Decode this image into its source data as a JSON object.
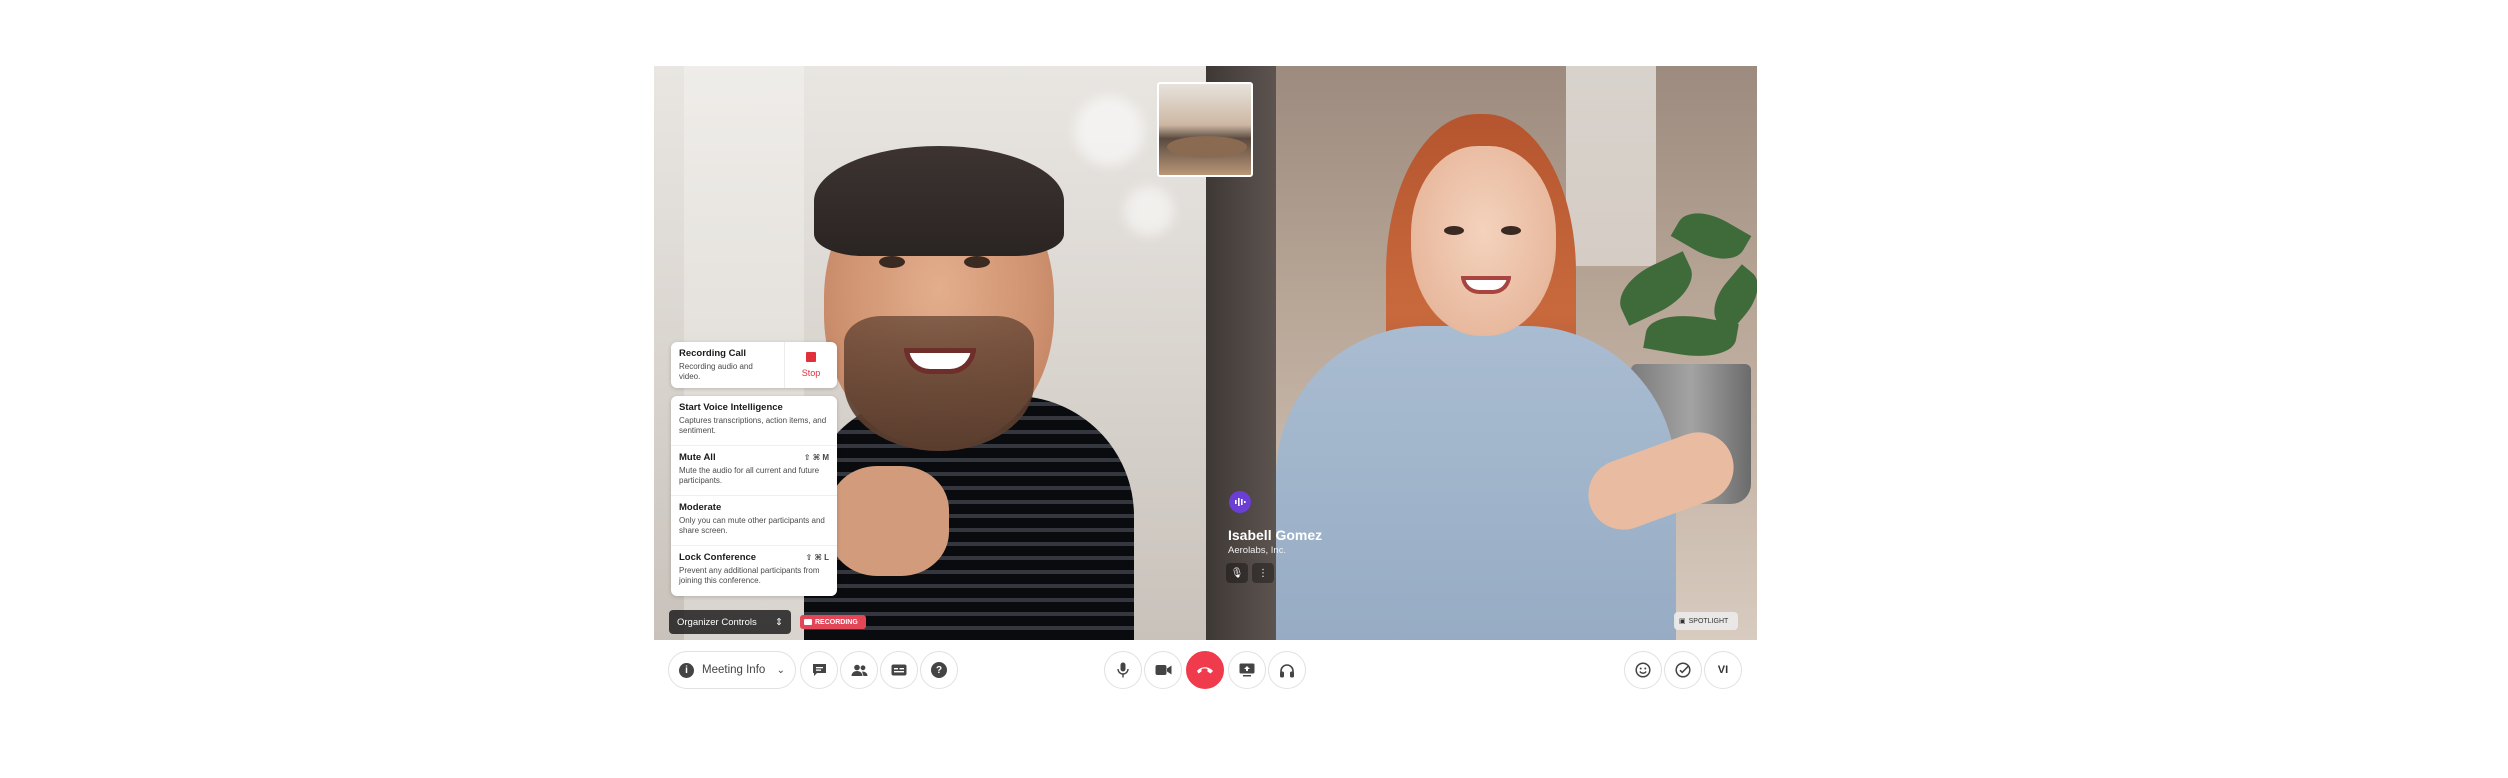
{
  "recording": {
    "title": "Recording Call",
    "description": "Recording audio and video.",
    "stop_label": "Stop"
  },
  "organizer_menu": [
    {
      "title": "Start Voice Intelligence",
      "description": "Captures transcriptions, action items, and sentiment.",
      "shortcut": ""
    },
    {
      "title": "Mute All",
      "description": "Mute the audio for all current and future participants.",
      "shortcut": "⇧ ⌘ M"
    },
    {
      "title": "Moderate",
      "description": "Only you can mute other participants and share screen.",
      "shortcut": ""
    },
    {
      "title": "Lock Conference",
      "description": "Prevent any additional participants from joining this conference.",
      "shortcut": "⇧ ⌘ L"
    }
  ],
  "organizer_controls": {
    "label": "Organizer Controls",
    "icon": "updown-icon"
  },
  "recording_badge": {
    "label": "RECORDING"
  },
  "speaker": {
    "name": "Isabell Gomez",
    "company": "Aerolabs, Inc."
  },
  "spotlight": {
    "label": "SPOTLIGHT"
  },
  "toolbar": {
    "meeting_info_label": "Meeting Info",
    "avatar_initials": "VI"
  },
  "colors": {
    "end_call": "#ef3b4b",
    "recording": "#e0303c",
    "speaker_dot": "#6b3fd6"
  }
}
